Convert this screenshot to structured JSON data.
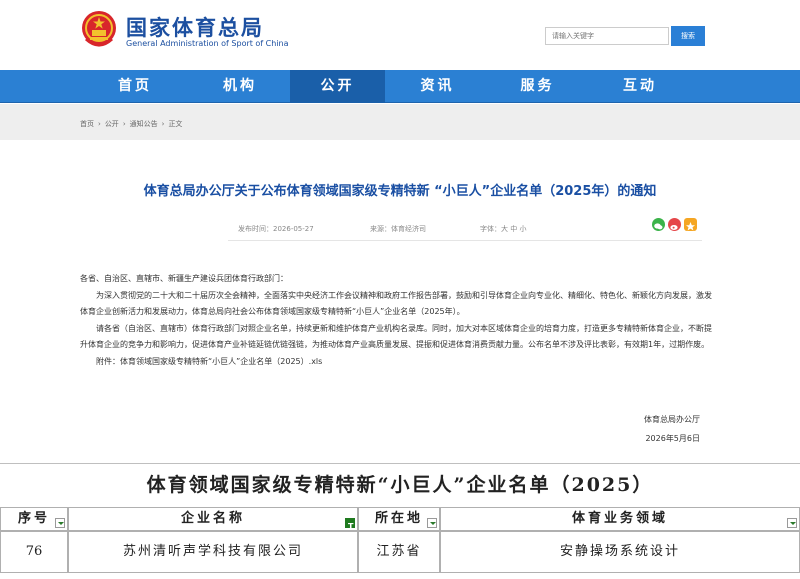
{
  "header": {
    "site_name_cn": "国家体育总局",
    "site_name_en": "General Administration of Sport of China",
    "search_placeholder": "请输入关键字",
    "search_button": "搜索",
    "brand_color": "#1c4fa0"
  },
  "nav": {
    "items": [
      {
        "label": "首页",
        "active": false
      },
      {
        "label": "机构",
        "active": false
      },
      {
        "label": "公开",
        "active": true
      },
      {
        "label": "资讯",
        "active": false
      },
      {
        "label": "服务",
        "active": false
      },
      {
        "label": "互动",
        "active": false
      }
    ],
    "color": "#2b80d3",
    "active_color": "#1a5fa9"
  },
  "breadcrumb": [
    "首页",
    "›",
    "公开",
    "›",
    "通知公告",
    "›",
    "正文"
  ],
  "article": {
    "title": "体育总局办公厅关于公布体育领域国家级专精特新 “小巨人”企业名单（2025年）的通知",
    "publish_date": "发布时间：2026-05-27",
    "source": "来源：体育经济司",
    "font_size": "字体：大 中 小",
    "share_icons": [
      "wechat-icon",
      "weibo-icon",
      "favorite-icon"
    ],
    "salutation": "各省、自治区、直辖市、新疆生产建设兵团体育行政部门：",
    "paragraph1": "为深入贯彻党的二十大和二十届历次全会精神，全面落实中央经济工作会议精神和政府工作报告部署，鼓励和引导体育企业向专业化、精细化、特色化、新颖化方向发展，激发体育企业创新活力和发展动力，体育总局向社会公布体育领域国家级专精特新“小巨人”企业名单（2025年）。",
    "paragraph2": "请各省（自治区、直辖市）体育行政部门对照企业名单，持续更新和维护体育产业机构名录库。同时，加大对本区域体育企业的培育力度，打造更多专精特新体育企业，不断提升体育企业的竞争力和影响力，促进体育产业补链延链优链强链，为推动体育产业高质量发展、提振和促进体育消费贡献力量。公布名单不涉及评比表彰，有效期1年，过期作废。",
    "attachment": "附件：体育领域国家级专精特新“小巨人”企业名单（2025）.xls",
    "signature": "体育总局办公厅",
    "sign_date": "2026年5月6日"
  },
  "sheet": {
    "title": "体育领域国家级专精特新“小巨人”企业名单（2025）",
    "columns": [
      "序号",
      "企业名称",
      "所在地",
      "体育业务领域"
    ],
    "rows": [
      [
        "76",
        "苏州清听声学科技有限公司",
        "江苏省",
        "安静操场系统设计"
      ]
    ],
    "filter_color": "#1f7a1f"
  }
}
